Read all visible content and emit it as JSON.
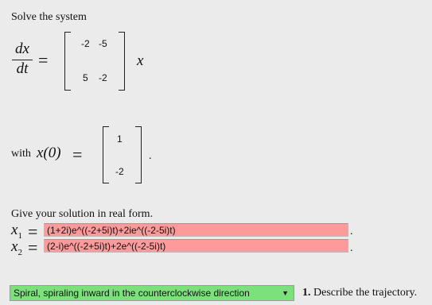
{
  "problem": {
    "intro": "Solve the system",
    "lhs_num": "dx",
    "lhs_den": "dt",
    "equals": "=",
    "matrix": {
      "r1c1": "-2",
      "r1c2": "-5",
      "r2c1": "5",
      "r2c2": "-2"
    },
    "rhs_var": "x",
    "with_label": "with",
    "initial_lhs": "x(0)",
    "initial_vec": [
      "1",
      "-2"
    ],
    "period": "."
  },
  "answer": {
    "instruction": "Give your solution in real form.",
    "x1_label": "x",
    "x1_sub": "1",
    "x1_value": "(1+2i)e^((-2+5i)t)+2ie^((-2-5i)t)",
    "x2_label": "x",
    "x2_sub": "2",
    "x2_value": "(2-i)e^((-2+5i)t)+2e^((-2-5i)t)",
    "trail_dot": "."
  },
  "trajectory": {
    "selected": "Spiral, spiraling inward in the counterclockwise direction",
    "number": "1.",
    "prompt": "Describe the trajectory."
  },
  "colors": {
    "incorrect": "#ff9a9a",
    "correct": "#7be27b",
    "background": "#ebebeb"
  }
}
